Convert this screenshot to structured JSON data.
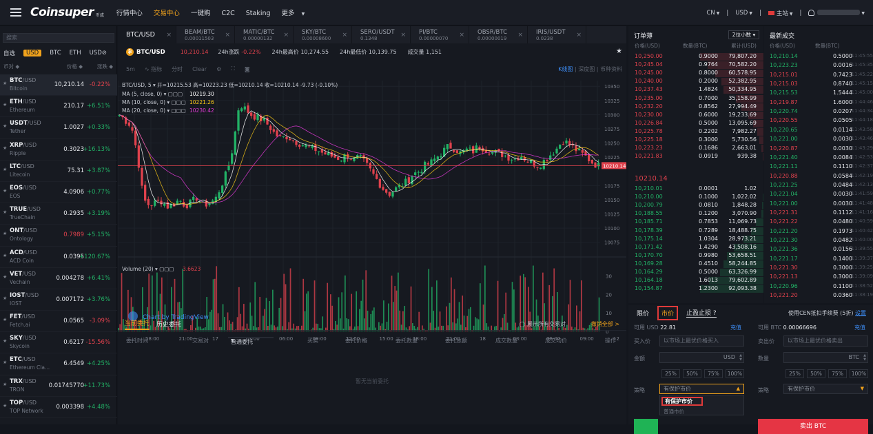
{
  "nav": {
    "logo": "Coinsuper",
    "logo_sub": "币成",
    "items": [
      {
        "label": "行情中心",
        "active": false
      },
      {
        "label": "交易中心",
        "active": true
      },
      {
        "label": "一键购",
        "active": false
      },
      {
        "label": "C2C",
        "active": false
      },
      {
        "label": "Staking",
        "active": false
      },
      {
        "label": "更多",
        "active": false
      }
    ],
    "lang": "CN",
    "currency": "USD",
    "station": "主站",
    "user": ""
  },
  "market": {
    "search_placeholder": "搜索",
    "tabs": [
      "自选",
      "USD",
      "BTC",
      "ETH",
      "USD⊘"
    ],
    "active_tab": "USD",
    "col_pair": "币对 ◆",
    "col_price": "价格 ◆",
    "col_change": "涨跌 ◆",
    "rows": [
      {
        "base": "BTC",
        "quote": "/USD",
        "name": "Bitcoin",
        "price": "10,210.14",
        "change": "-0.22%",
        "dir": "dn",
        "price_red": false
      },
      {
        "base": "ETH",
        "quote": "/USD",
        "name": "Ethereum",
        "price": "210.17",
        "change": "+6.51%",
        "dir": "up",
        "price_red": false
      },
      {
        "base": "USDT",
        "quote": "/USD",
        "name": "Tether",
        "price": "1.0027",
        "change": "+0.33%",
        "dir": "up",
        "price_red": false
      },
      {
        "base": "XRP",
        "quote": "/USD",
        "name": "Ripple",
        "price": "0.3023",
        "change": "+16.13%",
        "dir": "up",
        "price_red": false
      },
      {
        "base": "LTC",
        "quote": "/USD",
        "name": "Litecoin",
        "price": "75.31",
        "change": "+3.87%",
        "dir": "up",
        "price_red": false
      },
      {
        "base": "EOS",
        "quote": "/USD",
        "name": "EOS",
        "price": "4.0906",
        "change": "+0.77%",
        "dir": "up",
        "price_red": false
      },
      {
        "base": "TRUE",
        "quote": "/USD",
        "name": "TrueChain",
        "price": "0.2935",
        "change": "+3.19%",
        "dir": "up",
        "price_red": false
      },
      {
        "base": "ONT",
        "quote": "/USD",
        "name": "Ontology",
        "price": "0.7989",
        "change": "+5.15%",
        "dir": "up",
        "price_red": true
      },
      {
        "base": "ACD",
        "quote": "/USD",
        "name": "ACD Coin",
        "price": "0.0395",
        "change": "+120.67%",
        "dir": "up",
        "price_red": false
      },
      {
        "base": "VET",
        "quote": "/USD",
        "name": "Vechain",
        "price": "0.004278",
        "change": "+6.41%",
        "dir": "up",
        "price_red": false
      },
      {
        "base": "IOST",
        "quote": "/USD",
        "name": "IOST",
        "price": "0.007172",
        "change": "+3.76%",
        "dir": "up",
        "price_red": false
      },
      {
        "base": "FET",
        "quote": "/USD",
        "name": "Fetch.ai",
        "price": "0.0565",
        "change": "-3.09%",
        "dir": "dn",
        "price_red": false
      },
      {
        "base": "SKY",
        "quote": "/USD",
        "name": "Skycoin",
        "price": "0.6217",
        "change": "-15.56%",
        "dir": "dn",
        "price_red": false
      },
      {
        "base": "ETC",
        "quote": "/USD",
        "name": "Ethereum Cla...",
        "price": "6.4549",
        "change": "+4.25%",
        "dir": "up",
        "price_red": false
      },
      {
        "base": "TRX",
        "quote": "/USD",
        "name": "TRON",
        "price": "0.01745770",
        "change": "+11.73%",
        "dir": "up",
        "price_red": false
      },
      {
        "base": "TOP",
        "quote": "/USD",
        "name": "TOP Network",
        "price": "0.003398",
        "change": "+4.48%",
        "dir": "up",
        "price_red": false
      }
    ]
  },
  "tabs": [
    {
      "pair": "BTC/USD",
      "price": "",
      "active": true
    },
    {
      "pair": "BEAM/BTC",
      "price": "0.00011503",
      "active": false
    },
    {
      "pair": "MATIC/BTC",
      "price": "0.00000132",
      "active": false
    },
    {
      "pair": "SKY/BTC",
      "price": "0.00008600",
      "active": false
    },
    {
      "pair": "SERO/USDT",
      "price": "0.1348",
      "active": false
    },
    {
      "pair": "PI/BTC",
      "price": "0.00000070",
      "active": false
    },
    {
      "pair": "OBSR/BTC",
      "price": "0.00000019",
      "active": false
    },
    {
      "pair": "IRIS/USDT",
      "price": "0.0238",
      "active": false
    }
  ],
  "ticker": {
    "symbol": "BTC/USD",
    "price": "10,210.14",
    "change_label": "24h涨跌",
    "change": "-0.22%",
    "high_label": "24h最高价",
    "high": "10,274.55",
    "low_label": "24h最低价",
    "low": "10,139.75",
    "vol_label": "成交量",
    "vol": "1,151"
  },
  "toolbar": {
    "interval": "5m",
    "indicators": "指标",
    "timeshare": "分时",
    "clear": "Clear",
    "right": "K线图",
    "depth": "深度图",
    "info": "币种资料"
  },
  "chart_data": {
    "type": "candlestick",
    "legend_main": "BTC/USD, 5",
    "ohlc": {
      "open_label": "开=",
      "open": "10215.53",
      "high_label": "高=",
      "high": "10223.23",
      "low_label": "低=",
      "low": "10210.14",
      "close_label": "收=",
      "close": "10210.14",
      "chg": "-9.73 (-0.10%)"
    },
    "ma": [
      {
        "label": "MA (5, close, 0)",
        "value": "10219.30",
        "color": "#ffffff"
      },
      {
        "label": "MA (10, close, 0)",
        "value": "10221.26",
        "color": "#f5c518"
      },
      {
        "label": "MA (20, close, 0)",
        "value": "10230.42",
        "color": "#e03ad6"
      }
    ],
    "yticks": [
      10350,
      10325,
      10300,
      10275,
      10250,
      10225,
      10175,
      10150,
      10125,
      10100,
      10075
    ],
    "ylim": [
      10060,
      10360
    ],
    "last_price": "10210.14",
    "xticks": [
      "18:00",
      "21:00",
      "17",
      "03:00",
      "06:00",
      "09:00",
      "12:00",
      "15:00",
      "18:00",
      "21:00",
      "18",
      "03:00",
      "06:00",
      "09:00",
      "12"
    ],
    "close_path": [
      10300,
      10290,
      10280,
      10230,
      10150,
      10140,
      10145,
      10148,
      10138,
      10142,
      10150,
      10140,
      10145,
      10155,
      10140,
      10145,
      10150,
      10175,
      10200,
      10245,
      10320,
      10310,
      10300,
      10295,
      10290,
      10280,
      10265,
      10258,
      10262,
      10255,
      10250,
      10245,
      10240,
      10238,
      10232,
      10228,
      10225,
      10222,
      10230,
      10220,
      10225,
      10215,
      10200,
      10185,
      10170,
      10160,
      10168,
      10175,
      10182,
      10195,
      10200,
      10210,
      10215,
      10225,
      10235,
      10245,
      10240,
      10232,
      10238,
      10235,
      10245,
      10240,
      10235,
      10232,
      10230,
      10225,
      10222,
      10228,
      10220,
      10215,
      10210,
      10220,
      10230,
      10240,
      10255,
      10248,
      10240,
      10232,
      10225,
      10215,
      10210
    ],
    "volume_label": "Volume (20)",
    "volume_value": "3.6623",
    "vol_yticks": [
      30,
      20,
      10,
      0
    ],
    "vol_ylim": [
      0,
      38
    ],
    "watermark": "Chart by TradingView"
  },
  "orders": {
    "tab_current": "当前委托",
    "tab_history": "历史委托",
    "show_all": "展示所有交易对",
    "cancel_all": "撤销全部 >",
    "cols": [
      "委托时间",
      "交易对",
      "普通委托",
      "买卖",
      "委托价格",
      "委托数量",
      "委托总额",
      "成交数量",
      "成交均价",
      "操作"
    ],
    "empty": "暂无当前委托"
  },
  "book": {
    "title": "订单薄",
    "decimals": "2位小数",
    "col_price": "价格(USD)",
    "col_amount": "数量(BTC)",
    "col_total": "累计(USD)",
    "asks": [
      [
        "10,250.00",
        "0.9000",
        "79,807.20",
        1.0
      ],
      [
        "10,245.04",
        "0.9764",
        "70,582.20",
        0.88
      ],
      [
        "10,245.00",
        "0.8000",
        "60,578.95",
        0.76
      ],
      [
        "10,240.00",
        "0.2000",
        "52,382.95",
        0.66
      ],
      [
        "10,237.43",
        "1.4824",
        "50,334.95",
        0.63
      ],
      [
        "10,235.00",
        "0.7000",
        "35,158.99",
        0.44
      ],
      [
        "10,232.20",
        "0.8562",
        "27,994.49",
        0.35
      ],
      [
        "10,230.00",
        "0.6000",
        "19,233.69",
        0.24
      ],
      [
        "10,226.84",
        "0.5000",
        "13,095.69",
        0.16
      ],
      [
        "10,225.78",
        "0.2202",
        "7,982.27",
        0.1
      ],
      [
        "10,225.18",
        "0.3000",
        "5,730.56",
        0.07
      ],
      [
        "10,223.23",
        "0.1686",
        "2,663.01",
        0.03
      ],
      [
        "10,221.83",
        "0.0919",
        "939.38",
        0.01
      ]
    ],
    "mid": "10210.14",
    "bids": [
      [
        "10,210.01",
        "0.0001",
        "1.02",
        0.0
      ],
      [
        "10,210.00",
        "0.1000",
        "1,022.02",
        0.01
      ],
      [
        "10,200.79",
        "0.0810",
        "1,848.28",
        0.02
      ],
      [
        "10,188.55",
        "0.1200",
        "3,070.90",
        0.03
      ],
      [
        "10,185.71",
        "0.7853",
        "11,069.73",
        0.12
      ],
      [
        "10,178.39",
        "0.7289",
        "18,488.75",
        0.2
      ],
      [
        "10,175.14",
        "1.0304",
        "28,973.21",
        0.31
      ],
      [
        "10,171.42",
        "1.4290",
        "43,508.16",
        0.47
      ],
      [
        "10,170.70",
        "0.9980",
        "53,658.51",
        0.58
      ],
      [
        "10,169.28",
        "0.4510",
        "58,244.85",
        0.63
      ],
      [
        "10,164.29",
        "0.5000",
        "63,326.99",
        0.69
      ],
      [
        "10,164.18",
        "1.6013",
        "79,602.89",
        0.86
      ],
      [
        "10,154.87",
        "1.2300",
        "92,093.38",
        1.0
      ]
    ]
  },
  "trades": {
    "title": "最新成交",
    "col_price": "价格(USD)",
    "col_amount": "数量(BTC)",
    "col_time": "时间",
    "rows": [
      [
        "10,210.14",
        "0.5000",
        "11:45:55",
        "up"
      ],
      [
        "10,223.23",
        "0.0016",
        "11:45:35",
        "up"
      ],
      [
        "10,215.01",
        "0.7423",
        "11:45:22",
        "dn"
      ],
      [
        "10,215.03",
        "0.8740",
        "11:45:15",
        "dn"
      ],
      [
        "10,215.53",
        "1.5444",
        "11:45:00",
        "up"
      ],
      [
        "10,219.87",
        "1.6000",
        "11:44:46",
        "dn"
      ],
      [
        "10,220.74",
        "0.0207",
        "11:44:34",
        "up"
      ],
      [
        "10,220.55",
        "0.0505",
        "11:44:18",
        "dn"
      ],
      [
        "10,220.65",
        "0.0114",
        "11:43:58",
        "up"
      ],
      [
        "10,221.00",
        "0.0030",
        "11:43:46",
        "up"
      ],
      [
        "10,220.87",
        "0.0030",
        "11:43:29",
        "dn"
      ],
      [
        "10,221.40",
        "0.0084",
        "11:42:53",
        "up"
      ],
      [
        "10,221.11",
        "0.1110",
        "11:42:37",
        "up"
      ],
      [
        "10,220.88",
        "0.0584",
        "11:42:19",
        "dn"
      ],
      [
        "10,221.25",
        "0.0484",
        "11:42:13",
        "up"
      ],
      [
        "10,221.04",
        "0.0030",
        "11:41:59",
        "up"
      ],
      [
        "10,221.00",
        "0.0030",
        "11:41:48",
        "up"
      ],
      [
        "10,221.31",
        "0.1112",
        "11:41:16",
        "dn"
      ],
      [
        "10,221.22",
        "0.0480",
        "11:40:59",
        "dn"
      ],
      [
        "10,221.20",
        "0.1973",
        "11:40:42",
        "up"
      ],
      [
        "10,221.30",
        "0.0482",
        "11:40:00",
        "up"
      ],
      [
        "10,221.36",
        "0.0156",
        "11:39:55",
        "up"
      ],
      [
        "10,221.17",
        "0.1400",
        "11:39:37",
        "up"
      ],
      [
        "10,221.30",
        "0.3000",
        "11:39:25",
        "dn"
      ],
      [
        "10,221.13",
        "0.3000",
        "11:39:09",
        "dn"
      ],
      [
        "10,220.96",
        "0.1100",
        "11:38:52",
        "up"
      ],
      [
        "10,221.20",
        "0.0360",
        "11:38:19",
        "dn"
      ]
    ]
  },
  "form": {
    "tab_limit": "限价",
    "tab_market": "市价",
    "tab_stop": "止盈止损",
    "fee_text": "使用CEN抵扣手续费 (5折)",
    "fee_link": "设置",
    "buy": {
      "avail_label": "可用 USD",
      "avail": "22.81",
      "recharge": "充值",
      "price_label": "买入价",
      "price_placeholder": "以市场上最优价格买入",
      "amount_label": "金额",
      "amount_unit": "USD",
      "pcts": [
        "25%",
        "50%",
        "75%",
        "100%"
      ],
      "strategy_label": "策略",
      "strategy_value": "有保护市价",
      "options": [
        "有保护市价",
        "普通市价"
      ]
    },
    "sell": {
      "avail_label": "可用 BTC",
      "avail": "0.00066696",
      "recharge": "充值",
      "price_label": "卖出价",
      "price_placeholder": "以市场上最优价格卖出",
      "amount_label": "数量",
      "amount_unit": "BTC",
      "pcts": [
        "25%",
        "50%",
        "75%",
        "100%"
      ],
      "strategy_label": "策略",
      "strategy_value": "有保护市价",
      "button": "卖出 BTC"
    }
  },
  "colors": {
    "up": "#22b266",
    "down": "#e0424d",
    "accent": "#f0a21c",
    "link": "#3e8ef7"
  }
}
